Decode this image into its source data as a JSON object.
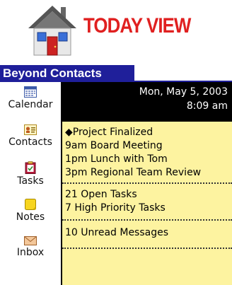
{
  "header": {
    "title": "TODAY VIEW",
    "icon": "house-icon",
    "colors": {
      "title": "#e02020",
      "roof": "#555555",
      "walls": "#e8e8e8",
      "door": "#cc2222",
      "windows": "#3a6fd8"
    }
  },
  "app": {
    "title": "Beyond Contacts",
    "colors": {
      "title_bar": "#1f1f9a",
      "panel_bg": "#fdf3a0",
      "date_panel_bg": "#000000"
    }
  },
  "sidebar": {
    "items": [
      {
        "label": "Calendar",
        "icon": "calendar-icon"
      },
      {
        "label": "Contacts",
        "icon": "contacts-card-icon"
      },
      {
        "label": "Tasks",
        "icon": "tasks-clipboard-icon"
      },
      {
        "label": "Notes",
        "icon": "notes-icon"
      },
      {
        "label": "Inbox",
        "icon": "inbox-envelope-icon"
      }
    ]
  },
  "main": {
    "date": "Mon, May 5, 2003",
    "time": "8:09 am",
    "events": [
      "◆Project Finalized",
      "9am Board Meeting",
      "1pm Lunch with Tom",
      "3pm Regional Team Review"
    ],
    "tasks": [
      "21 Open Tasks",
      "7 High Priority Tasks"
    ],
    "messages": [
      "10 Unread Messages"
    ]
  }
}
